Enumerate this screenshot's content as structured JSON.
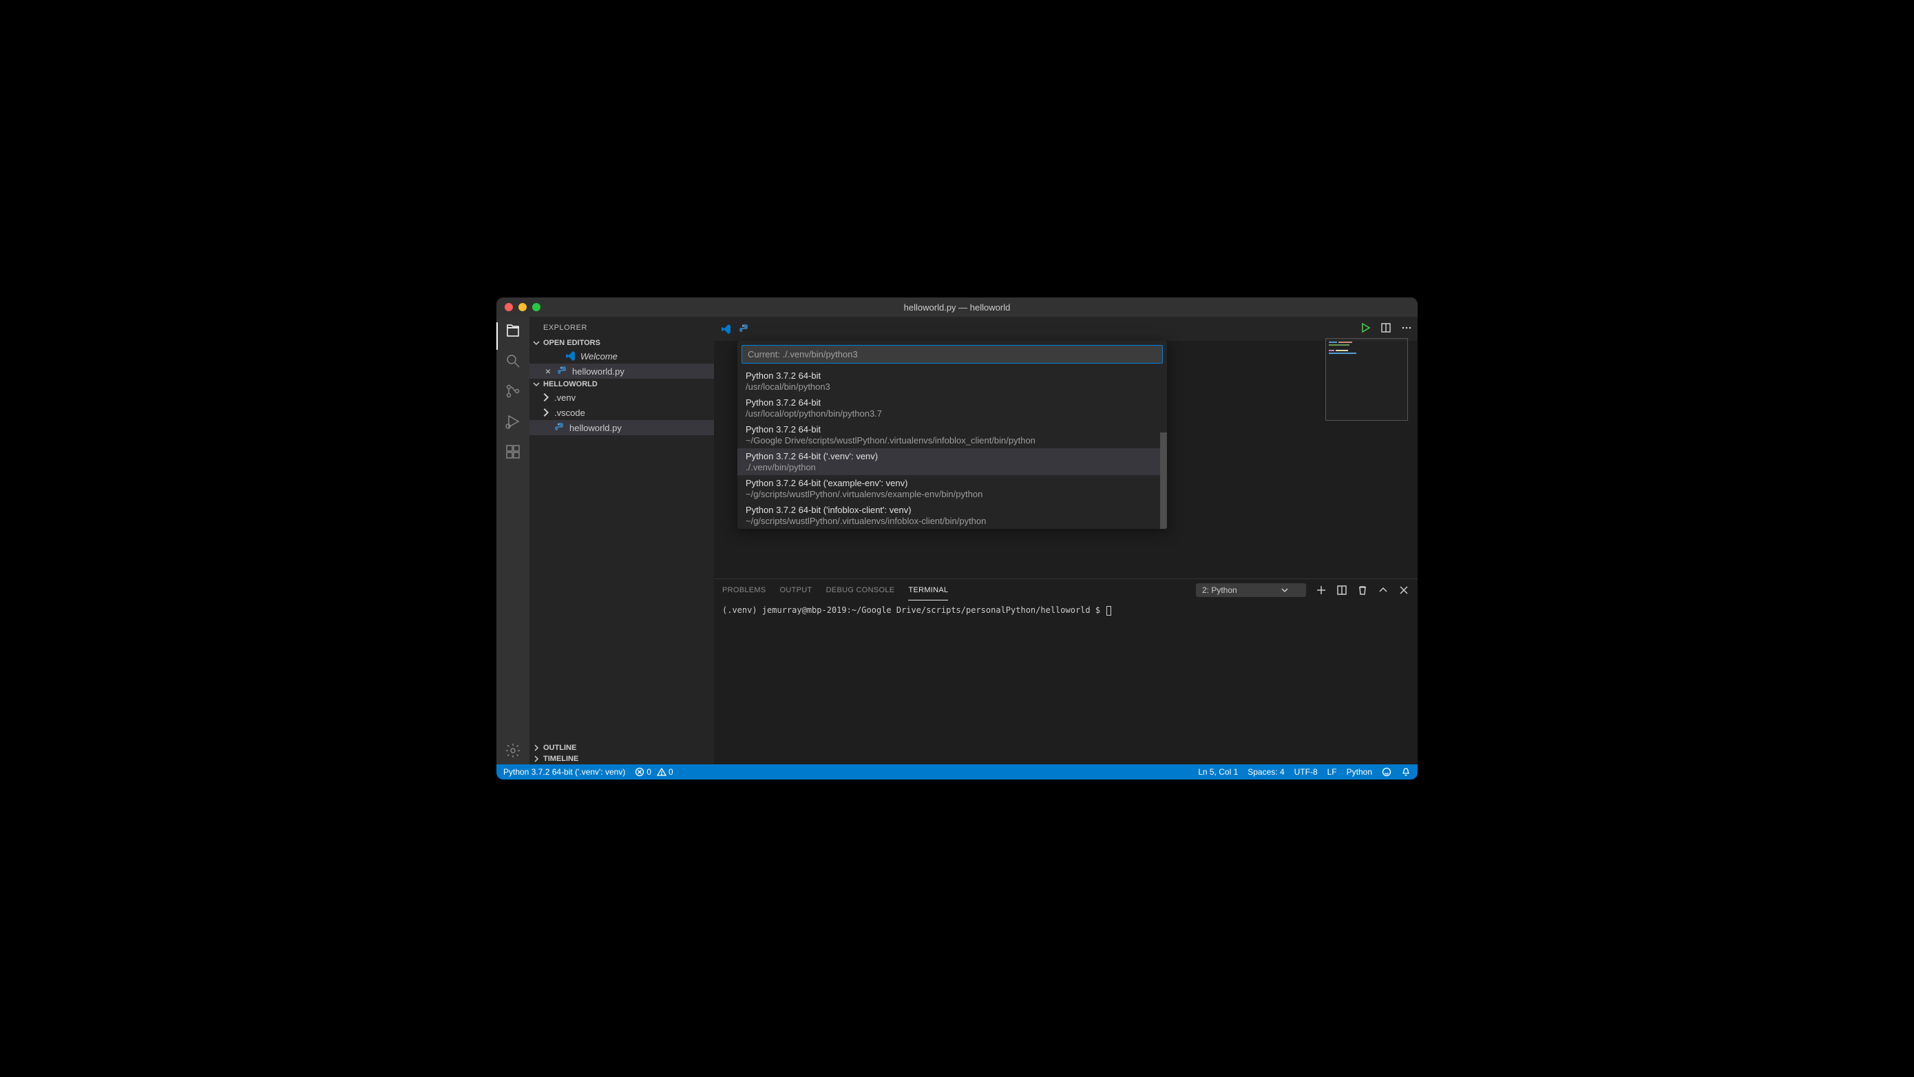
{
  "title": "helloworld.py — helloworld",
  "sidebar": {
    "header": "EXPLORER",
    "openEditors": {
      "label": "OPEN EDITORS",
      "items": [
        {
          "label": "Welcome",
          "italic": true,
          "close": ""
        },
        {
          "label": "helloworld.py",
          "close": "×"
        }
      ]
    },
    "workspace": {
      "label": "HELLOWORLD",
      "items": [
        {
          "label": ".venv",
          "type": "folder"
        },
        {
          "label": ".vscode",
          "type": "folder"
        },
        {
          "label": "helloworld.py",
          "type": "file",
          "selected": true
        }
      ]
    },
    "outline": "OUTLINE",
    "timeline": "TIMELINE"
  },
  "quickpick": {
    "placeholder": "Current: ./.venv/bin/python3",
    "items": [
      {
        "label": "Python 3.7.2 64-bit",
        "desc": "/usr/local/bin/python3"
      },
      {
        "label": "Python 3.7.2 64-bit",
        "desc": "/usr/local/opt/python/bin/python3.7"
      },
      {
        "label": "Python 3.7.2 64-bit",
        "desc": "~/Google Drive/scripts/wustlPython/.virtualenvs/infoblox_client/bin/python"
      },
      {
        "label": "Python 3.7.2 64-bit ('.venv': venv)",
        "desc": "./.venv/bin/python",
        "selected": true
      },
      {
        "label": "Python 3.7.2 64-bit ('example-env': venv)",
        "desc": "~/g/scripts/wustlPython/.virtualenvs/example-env/bin/python"
      },
      {
        "label": "Python 3.7.2 64-bit ('infoblox-client': venv)",
        "desc": "~/g/scripts/wustlPython/.virtualenvs/infoblox-client/bin/python"
      }
    ]
  },
  "panel": {
    "tabs": [
      "PROBLEMS",
      "OUTPUT",
      "DEBUG CONSOLE",
      "TERMINAL"
    ],
    "activeTab": "TERMINAL",
    "terminalSelect": "2: Python",
    "terminalLine": "(.venv) jemurray@mbp-2019:~/Google Drive/scripts/personalPython/helloworld $"
  },
  "statusbar": {
    "interpreter": "Python 3.7.2 64-bit ('.venv': venv)",
    "errors": "0",
    "warnings": "0",
    "position": "Ln 5, Col 1",
    "spaces": "Spaces: 4",
    "encoding": "UTF-8",
    "eol": "LF",
    "language": "Python"
  }
}
